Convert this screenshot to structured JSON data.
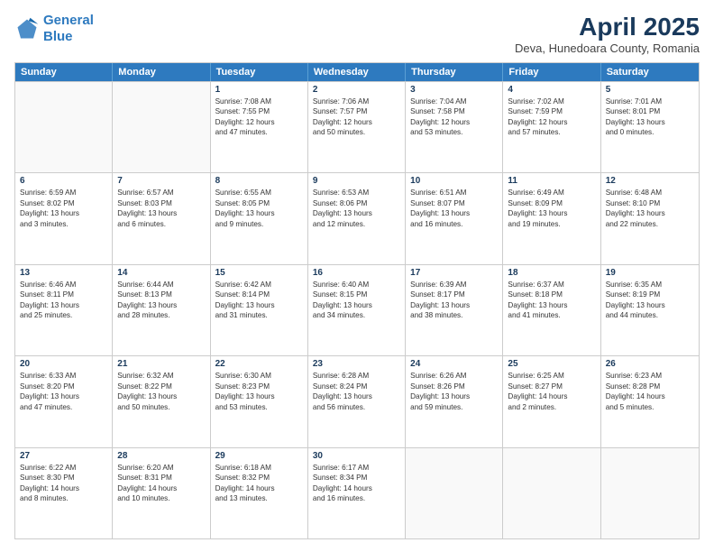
{
  "logo": {
    "line1": "General",
    "line2": "Blue"
  },
  "title": "April 2025",
  "subtitle": "Deva, Hunedoara County, Romania",
  "header_days": [
    "Sunday",
    "Monday",
    "Tuesday",
    "Wednesday",
    "Thursday",
    "Friday",
    "Saturday"
  ],
  "weeks": [
    [
      {
        "day": "",
        "lines": []
      },
      {
        "day": "",
        "lines": []
      },
      {
        "day": "1",
        "lines": [
          "Sunrise: 7:08 AM",
          "Sunset: 7:55 PM",
          "Daylight: 12 hours",
          "and 47 minutes."
        ]
      },
      {
        "day": "2",
        "lines": [
          "Sunrise: 7:06 AM",
          "Sunset: 7:57 PM",
          "Daylight: 12 hours",
          "and 50 minutes."
        ]
      },
      {
        "day": "3",
        "lines": [
          "Sunrise: 7:04 AM",
          "Sunset: 7:58 PM",
          "Daylight: 12 hours",
          "and 53 minutes."
        ]
      },
      {
        "day": "4",
        "lines": [
          "Sunrise: 7:02 AM",
          "Sunset: 7:59 PM",
          "Daylight: 12 hours",
          "and 57 minutes."
        ]
      },
      {
        "day": "5",
        "lines": [
          "Sunrise: 7:01 AM",
          "Sunset: 8:01 PM",
          "Daylight: 13 hours",
          "and 0 minutes."
        ]
      }
    ],
    [
      {
        "day": "6",
        "lines": [
          "Sunrise: 6:59 AM",
          "Sunset: 8:02 PM",
          "Daylight: 13 hours",
          "and 3 minutes."
        ]
      },
      {
        "day": "7",
        "lines": [
          "Sunrise: 6:57 AM",
          "Sunset: 8:03 PM",
          "Daylight: 13 hours",
          "and 6 minutes."
        ]
      },
      {
        "day": "8",
        "lines": [
          "Sunrise: 6:55 AM",
          "Sunset: 8:05 PM",
          "Daylight: 13 hours",
          "and 9 minutes."
        ]
      },
      {
        "day": "9",
        "lines": [
          "Sunrise: 6:53 AM",
          "Sunset: 8:06 PM",
          "Daylight: 13 hours",
          "and 12 minutes."
        ]
      },
      {
        "day": "10",
        "lines": [
          "Sunrise: 6:51 AM",
          "Sunset: 8:07 PM",
          "Daylight: 13 hours",
          "and 16 minutes."
        ]
      },
      {
        "day": "11",
        "lines": [
          "Sunrise: 6:49 AM",
          "Sunset: 8:09 PM",
          "Daylight: 13 hours",
          "and 19 minutes."
        ]
      },
      {
        "day": "12",
        "lines": [
          "Sunrise: 6:48 AM",
          "Sunset: 8:10 PM",
          "Daylight: 13 hours",
          "and 22 minutes."
        ]
      }
    ],
    [
      {
        "day": "13",
        "lines": [
          "Sunrise: 6:46 AM",
          "Sunset: 8:11 PM",
          "Daylight: 13 hours",
          "and 25 minutes."
        ]
      },
      {
        "day": "14",
        "lines": [
          "Sunrise: 6:44 AM",
          "Sunset: 8:13 PM",
          "Daylight: 13 hours",
          "and 28 minutes."
        ]
      },
      {
        "day": "15",
        "lines": [
          "Sunrise: 6:42 AM",
          "Sunset: 8:14 PM",
          "Daylight: 13 hours",
          "and 31 minutes."
        ]
      },
      {
        "day": "16",
        "lines": [
          "Sunrise: 6:40 AM",
          "Sunset: 8:15 PM",
          "Daylight: 13 hours",
          "and 34 minutes."
        ]
      },
      {
        "day": "17",
        "lines": [
          "Sunrise: 6:39 AM",
          "Sunset: 8:17 PM",
          "Daylight: 13 hours",
          "and 38 minutes."
        ]
      },
      {
        "day": "18",
        "lines": [
          "Sunrise: 6:37 AM",
          "Sunset: 8:18 PM",
          "Daylight: 13 hours",
          "and 41 minutes."
        ]
      },
      {
        "day": "19",
        "lines": [
          "Sunrise: 6:35 AM",
          "Sunset: 8:19 PM",
          "Daylight: 13 hours",
          "and 44 minutes."
        ]
      }
    ],
    [
      {
        "day": "20",
        "lines": [
          "Sunrise: 6:33 AM",
          "Sunset: 8:20 PM",
          "Daylight: 13 hours",
          "and 47 minutes."
        ]
      },
      {
        "day": "21",
        "lines": [
          "Sunrise: 6:32 AM",
          "Sunset: 8:22 PM",
          "Daylight: 13 hours",
          "and 50 minutes."
        ]
      },
      {
        "day": "22",
        "lines": [
          "Sunrise: 6:30 AM",
          "Sunset: 8:23 PM",
          "Daylight: 13 hours",
          "and 53 minutes."
        ]
      },
      {
        "day": "23",
        "lines": [
          "Sunrise: 6:28 AM",
          "Sunset: 8:24 PM",
          "Daylight: 13 hours",
          "and 56 minutes."
        ]
      },
      {
        "day": "24",
        "lines": [
          "Sunrise: 6:26 AM",
          "Sunset: 8:26 PM",
          "Daylight: 13 hours",
          "and 59 minutes."
        ]
      },
      {
        "day": "25",
        "lines": [
          "Sunrise: 6:25 AM",
          "Sunset: 8:27 PM",
          "Daylight: 14 hours",
          "and 2 minutes."
        ]
      },
      {
        "day": "26",
        "lines": [
          "Sunrise: 6:23 AM",
          "Sunset: 8:28 PM",
          "Daylight: 14 hours",
          "and 5 minutes."
        ]
      }
    ],
    [
      {
        "day": "27",
        "lines": [
          "Sunrise: 6:22 AM",
          "Sunset: 8:30 PM",
          "Daylight: 14 hours",
          "and 8 minutes."
        ]
      },
      {
        "day": "28",
        "lines": [
          "Sunrise: 6:20 AM",
          "Sunset: 8:31 PM",
          "Daylight: 14 hours",
          "and 10 minutes."
        ]
      },
      {
        "day": "29",
        "lines": [
          "Sunrise: 6:18 AM",
          "Sunset: 8:32 PM",
          "Daylight: 14 hours",
          "and 13 minutes."
        ]
      },
      {
        "day": "30",
        "lines": [
          "Sunrise: 6:17 AM",
          "Sunset: 8:34 PM",
          "Daylight: 14 hours",
          "and 16 minutes."
        ]
      },
      {
        "day": "",
        "lines": []
      },
      {
        "day": "",
        "lines": []
      },
      {
        "day": "",
        "lines": []
      }
    ]
  ]
}
